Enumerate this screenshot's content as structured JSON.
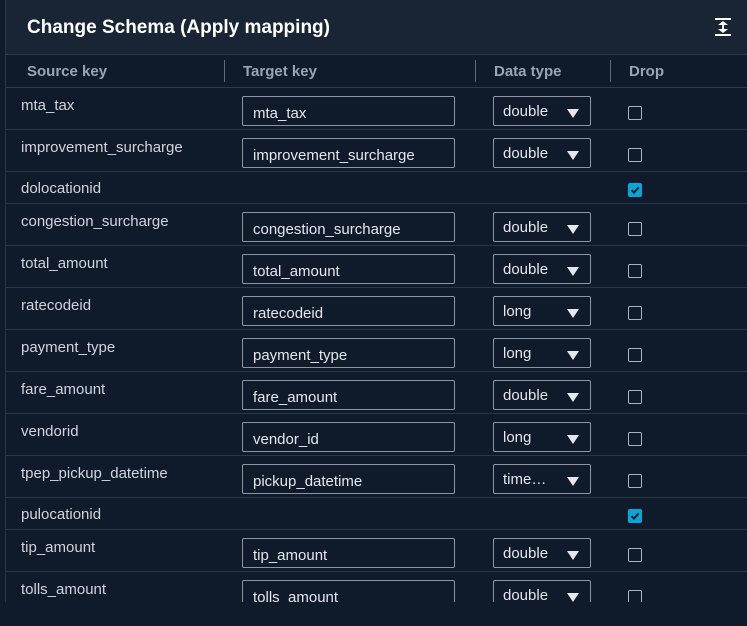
{
  "panel": {
    "title": "Change Schema (Apply mapping)",
    "expand_icon": "expand-vertical-icon"
  },
  "columns": {
    "source_key": "Source key",
    "target_key": "Target key",
    "data_type": "Data type",
    "drop": "Drop"
  },
  "rows": [
    {
      "source": "mta_tax",
      "target": "mta_tax",
      "type": "double",
      "drop": false
    },
    {
      "source": "improvement_surcharge",
      "target": "improvement_surcharge",
      "type": "double",
      "drop": false
    },
    {
      "source": "dolocationid",
      "target": null,
      "type": null,
      "drop": true
    },
    {
      "source": "congestion_surcharge",
      "target": "congestion_surcharge",
      "type": "double",
      "drop": false
    },
    {
      "source": "total_amount",
      "target": "total_amount",
      "type": "double",
      "drop": false
    },
    {
      "source": "ratecodeid",
      "target": "ratecodeid",
      "type": "long",
      "drop": false
    },
    {
      "source": "payment_type",
      "target": "payment_type",
      "type": "long",
      "drop": false
    },
    {
      "source": "fare_amount",
      "target": "fare_amount",
      "type": "double",
      "drop": false
    },
    {
      "source": "vendorid",
      "target": "vendor_id",
      "type": "long",
      "drop": false
    },
    {
      "source": "tpep_pickup_datetime",
      "target": "pickup_datetime",
      "type": "time…",
      "drop": false
    },
    {
      "source": "pulocationid",
      "target": null,
      "type": null,
      "drop": true
    },
    {
      "source": "tip_amount",
      "target": "tip_amount",
      "type": "double",
      "drop": false
    },
    {
      "source": "tolls_amount",
      "target": "tolls_amount",
      "type": "double",
      "drop": false
    }
  ],
  "colors": {
    "background": "#0f1b2a",
    "header": "#192534",
    "checkbox_checked": "#0aa5d6",
    "text": "#d1d5db"
  }
}
